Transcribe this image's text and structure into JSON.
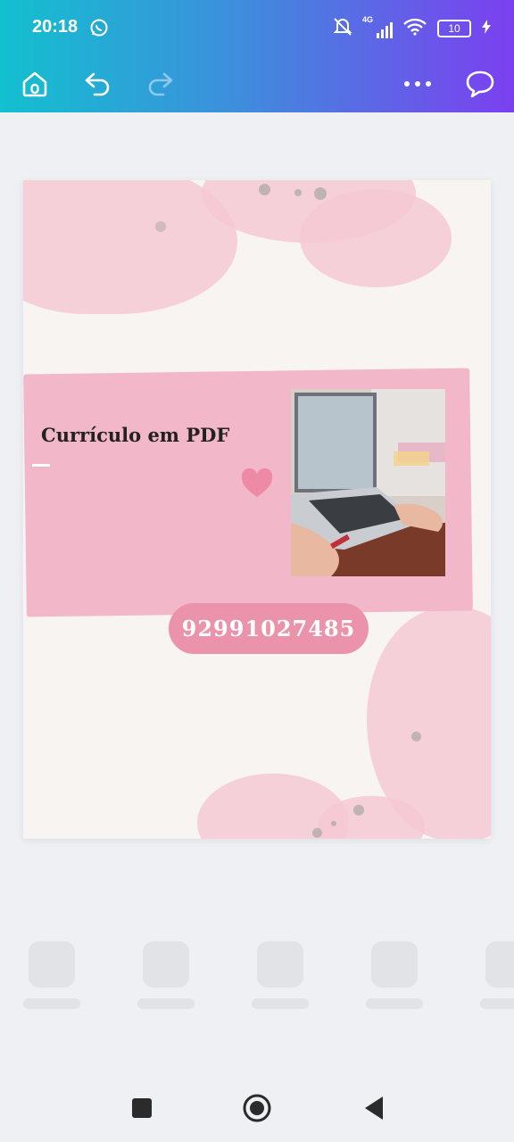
{
  "status_bar": {
    "time": "20:18",
    "network": "4G",
    "battery": "10"
  },
  "toolbar": {
    "icons": [
      "home-icon",
      "undo-icon",
      "redo-icon",
      "more-icon",
      "comment-icon"
    ]
  },
  "design": {
    "title": "Currículo em PDF",
    "phone": "92991027485",
    "colors": {
      "band": "#f2b7c8",
      "pill": "#ec93ac",
      "heart": "#ee8aa6",
      "paper": "#f8f4f1"
    }
  },
  "bottom_tools": {
    "count": 5
  },
  "nav": {
    "icons": [
      "recents-icon",
      "home-circle-icon",
      "back-icon"
    ]
  }
}
